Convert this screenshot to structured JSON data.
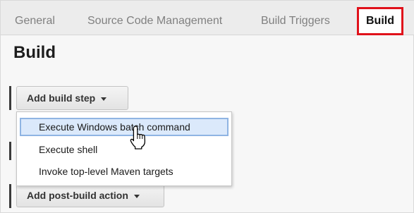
{
  "tabs": [
    {
      "label": "General"
    },
    {
      "label": "Source Code Management"
    },
    {
      "label": "Build Triggers"
    },
    {
      "label": "Build",
      "active": true
    }
  ],
  "section": {
    "title": "Build"
  },
  "build_step_button": {
    "label": "Add build step"
  },
  "build_step_menu": {
    "items": [
      {
        "label": "Execute Windows batch command",
        "highlighted": true
      },
      {
        "label": "Execute shell"
      },
      {
        "label": "Invoke top-level Maven targets"
      }
    ]
  },
  "post_build_button": {
    "label": "Add post-build action"
  },
  "colors": {
    "highlight_border": "#e0121b",
    "menu_hover_bg": "#dbe9fb",
    "menu_hover_border": "#8fb4e3"
  },
  "icons": {
    "cursor": "hand-pointer-icon",
    "dropdown": "caret-down-icon"
  }
}
